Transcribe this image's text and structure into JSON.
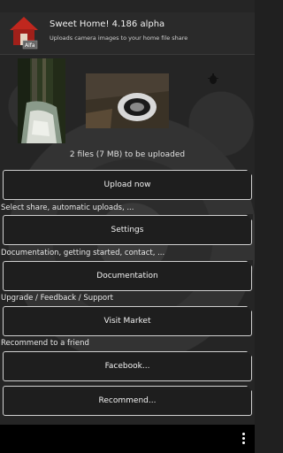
{
  "app": {
    "title": "Sweet Home! 4.186 alpha",
    "subtitle": "Uploads camera images to your home file share",
    "icon": "house-icon",
    "icon_badge": "Alfa"
  },
  "thumbnails": [
    {
      "name": "forest-stream-thumbnail"
    },
    {
      "name": "hole-in-wood-thumbnail"
    }
  ],
  "status": "2 files (7 MB) to be uploaded",
  "actions": {
    "upload_label": "Upload now",
    "settings_caption": "Select share, automatic uploads, ...",
    "settings_label": "Settings",
    "docs_caption": "Documentation, getting started, contact, ...",
    "docs_label": "Documentation",
    "market_caption": "Upgrade / Feedback / Support",
    "market_label": "Visit Market",
    "recommend_caption": "Recommend to a friend",
    "facebook_label": "Facebook...",
    "recommend_label": "Recommend..."
  },
  "navbar": {
    "overflow_icon": "overflow-menu-icon"
  },
  "colors": {
    "button_border": "#d0d0d0",
    "background": "#252525",
    "navbar": "#000000"
  }
}
